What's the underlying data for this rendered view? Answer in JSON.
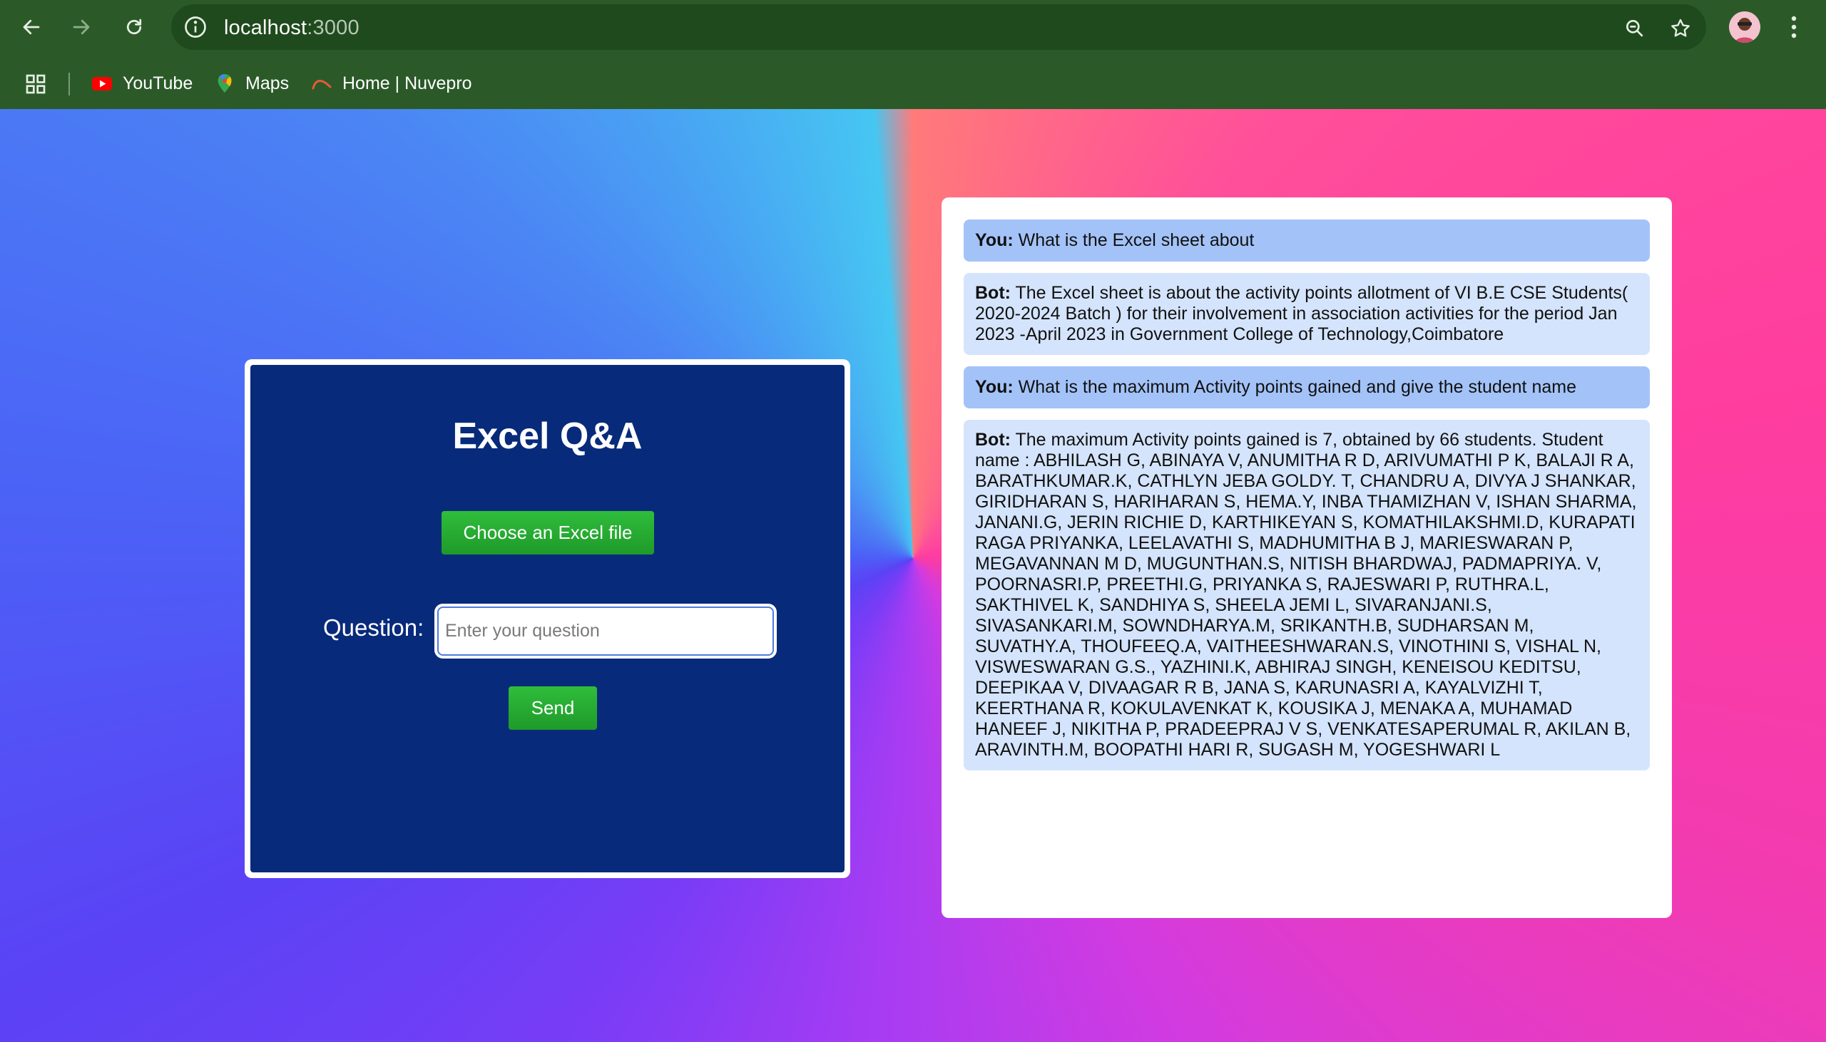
{
  "browser": {
    "url_host": "localhost",
    "url_port": ":3000",
    "bookmarks": [
      {
        "label": "YouTube",
        "icon": "youtube-icon"
      },
      {
        "label": "Maps",
        "icon": "maps-icon"
      },
      {
        "label": "Home | Nuvepro",
        "icon": "nuvepro-icon"
      }
    ]
  },
  "qa": {
    "title": "Excel Q&A",
    "file_button": "Choose an Excel file",
    "question_label": "Question:",
    "question_placeholder": "Enter your question",
    "send_button": "Send"
  },
  "chat": {
    "messages": [
      {
        "role": "user",
        "speaker": "You:",
        "text": "What is the Excel sheet about"
      },
      {
        "role": "bot",
        "speaker": "Bot:",
        "text": "The Excel sheet is about the activity points allotment of VI B.E CSE Students( 2020-2024 Batch ) for their involvement in association activities for the period Jan 2023 -April 2023 in Government College of Technology,Coimbatore"
      },
      {
        "role": "user",
        "speaker": "You:",
        "text": "What is the maximum Activity points gained and give the student name"
      },
      {
        "role": "bot",
        "speaker": "Bot:",
        "text": "The maximum Activity points gained is 7, obtained by 66 students. Student name : ABHILASH G, ABINAYA V, ANUMITHA R D, ARIVUMATHI P K, BALAJI R A, BARATHKUMAR.K, CATHLYN JEBA GOLDY. T, CHANDRU A, DIVYA J SHANKAR, GIRIDHARAN S, HARIHARAN S, HEMA.Y, INBA THAMIZHAN V, ISHAN SHARMA, JANANI.G, JERIN RICHIE D, KARTHIKEYAN S, KOMATHILAKSHMI.D, KURAPATI RAGA PRIYANKA, LEELAVATHI S, MADHUMITHA B J, MARIESWARAN P, MEGAVANNAN M D, MUGUNTHAN.S, NITISH BHARDWAJ, PADMAPRIYA. V, POORNASRI.P, PREETHI.G, PRIYANKA S, RAJESWARI P, RUTHRA.L, SAKTHIVEL K, SANDHIYA S, SHEELA JEMI L, SIVARANJANI.S, SIVASANKARI.M, SOWNDHARYA.M, SRIKANTH.B, SUDHARSAN M, SUVATHY.A, THOUFEEQ.A, VAITHEESHWARAN.S, VINOTHINI S, VISHAL N, VISWESWARAN G.S., YAZHINI.K, ABHIRAJ SINGH, KENEISOU KEDITSU, DEEPIKAA V, DIVAAGAR R B, JANA S, KARUNASRI A, KAYALVIZHI T, KEERTHANA R, KOKULAVENKAT K, KOUSIKA J, MENAKA A, MUHAMAD HANEEF J, NIKITHA P, PRADEEPRAJ V S, VENKATESAPERUMAL R, AKILAN B, ARAVINTH.M, BOOPATHI HARI R, SUGASH M, YOGESHWARI L"
      }
    ]
  }
}
